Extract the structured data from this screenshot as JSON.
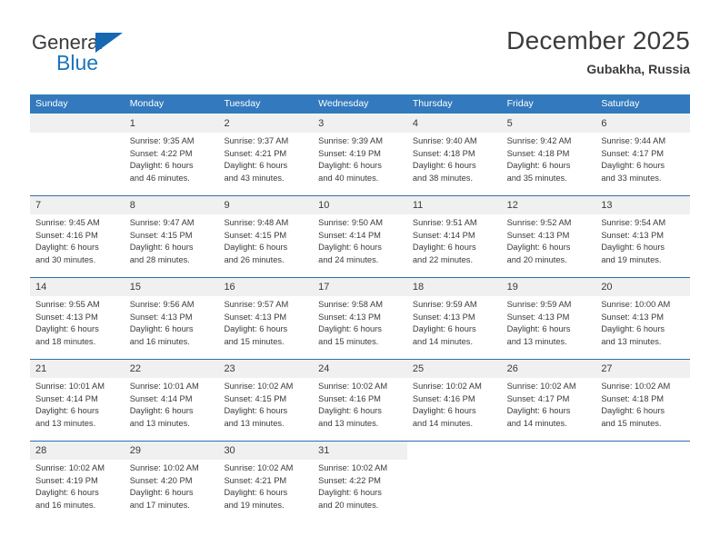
{
  "brand": {
    "name_top": "General",
    "name_bottom": "Blue",
    "triangle_icon": "blue-triangle-logo-mark",
    "colors": {
      "blue": "#1b75bc",
      "dark": "#3a3a3a"
    }
  },
  "header": {
    "title": "December 2025",
    "subtitle": "Gubakha, Russia"
  },
  "calendar": {
    "header_bg": "#3379bd",
    "header_text_color": "#ffffff",
    "daynum_band_bg": "#f0f0f0",
    "week_separator_color": "#2f6fb0",
    "weekdays": [
      "Sunday",
      "Monday",
      "Tuesday",
      "Wednesday",
      "Thursday",
      "Friday",
      "Saturday"
    ],
    "weeks": [
      [
        {
          "day": "",
          "lines": []
        },
        {
          "day": "1",
          "lines": [
            "Sunrise: 9:35 AM",
            "Sunset: 4:22 PM",
            "Daylight: 6 hours",
            "and 46 minutes."
          ]
        },
        {
          "day": "2",
          "lines": [
            "Sunrise: 9:37 AM",
            "Sunset: 4:21 PM",
            "Daylight: 6 hours",
            "and 43 minutes."
          ]
        },
        {
          "day": "3",
          "lines": [
            "Sunrise: 9:39 AM",
            "Sunset: 4:19 PM",
            "Daylight: 6 hours",
            "and 40 minutes."
          ]
        },
        {
          "day": "4",
          "lines": [
            "Sunrise: 9:40 AM",
            "Sunset: 4:18 PM",
            "Daylight: 6 hours",
            "and 38 minutes."
          ]
        },
        {
          "day": "5",
          "lines": [
            "Sunrise: 9:42 AM",
            "Sunset: 4:18 PM",
            "Daylight: 6 hours",
            "and 35 minutes."
          ]
        },
        {
          "day": "6",
          "lines": [
            "Sunrise: 9:44 AM",
            "Sunset: 4:17 PM",
            "Daylight: 6 hours",
            "and 33 minutes."
          ]
        }
      ],
      [
        {
          "day": "7",
          "lines": [
            "Sunrise: 9:45 AM",
            "Sunset: 4:16 PM",
            "Daylight: 6 hours",
            "and 30 minutes."
          ]
        },
        {
          "day": "8",
          "lines": [
            "Sunrise: 9:47 AM",
            "Sunset: 4:15 PM",
            "Daylight: 6 hours",
            "and 28 minutes."
          ]
        },
        {
          "day": "9",
          "lines": [
            "Sunrise: 9:48 AM",
            "Sunset: 4:15 PM",
            "Daylight: 6 hours",
            "and 26 minutes."
          ]
        },
        {
          "day": "10",
          "lines": [
            "Sunrise: 9:50 AM",
            "Sunset: 4:14 PM",
            "Daylight: 6 hours",
            "and 24 minutes."
          ]
        },
        {
          "day": "11",
          "lines": [
            "Sunrise: 9:51 AM",
            "Sunset: 4:14 PM",
            "Daylight: 6 hours",
            "and 22 minutes."
          ]
        },
        {
          "day": "12",
          "lines": [
            "Sunrise: 9:52 AM",
            "Sunset: 4:13 PM",
            "Daylight: 6 hours",
            "and 20 minutes."
          ]
        },
        {
          "day": "13",
          "lines": [
            "Sunrise: 9:54 AM",
            "Sunset: 4:13 PM",
            "Daylight: 6 hours",
            "and 19 minutes."
          ]
        }
      ],
      [
        {
          "day": "14",
          "lines": [
            "Sunrise: 9:55 AM",
            "Sunset: 4:13 PM",
            "Daylight: 6 hours",
            "and 18 minutes."
          ]
        },
        {
          "day": "15",
          "lines": [
            "Sunrise: 9:56 AM",
            "Sunset: 4:13 PM",
            "Daylight: 6 hours",
            "and 16 minutes."
          ]
        },
        {
          "day": "16",
          "lines": [
            "Sunrise: 9:57 AM",
            "Sunset: 4:13 PM",
            "Daylight: 6 hours",
            "and 15 minutes."
          ]
        },
        {
          "day": "17",
          "lines": [
            "Sunrise: 9:58 AM",
            "Sunset: 4:13 PM",
            "Daylight: 6 hours",
            "and 15 minutes."
          ]
        },
        {
          "day": "18",
          "lines": [
            "Sunrise: 9:59 AM",
            "Sunset: 4:13 PM",
            "Daylight: 6 hours",
            "and 14 minutes."
          ]
        },
        {
          "day": "19",
          "lines": [
            "Sunrise: 9:59 AM",
            "Sunset: 4:13 PM",
            "Daylight: 6 hours",
            "and 13 minutes."
          ]
        },
        {
          "day": "20",
          "lines": [
            "Sunrise: 10:00 AM",
            "Sunset: 4:13 PM",
            "Daylight: 6 hours",
            "and 13 minutes."
          ]
        }
      ],
      [
        {
          "day": "21",
          "lines": [
            "Sunrise: 10:01 AM",
            "Sunset: 4:14 PM",
            "Daylight: 6 hours",
            "and 13 minutes."
          ]
        },
        {
          "day": "22",
          "lines": [
            "Sunrise: 10:01 AM",
            "Sunset: 4:14 PM",
            "Daylight: 6 hours",
            "and 13 minutes."
          ]
        },
        {
          "day": "23",
          "lines": [
            "Sunrise: 10:02 AM",
            "Sunset: 4:15 PM",
            "Daylight: 6 hours",
            "and 13 minutes."
          ]
        },
        {
          "day": "24",
          "lines": [
            "Sunrise: 10:02 AM",
            "Sunset: 4:16 PM",
            "Daylight: 6 hours",
            "and 13 minutes."
          ]
        },
        {
          "day": "25",
          "lines": [
            "Sunrise: 10:02 AM",
            "Sunset: 4:16 PM",
            "Daylight: 6 hours",
            "and 14 minutes."
          ]
        },
        {
          "day": "26",
          "lines": [
            "Sunrise: 10:02 AM",
            "Sunset: 4:17 PM",
            "Daylight: 6 hours",
            "and 14 minutes."
          ]
        },
        {
          "day": "27",
          "lines": [
            "Sunrise: 10:02 AM",
            "Sunset: 4:18 PM",
            "Daylight: 6 hours",
            "and 15 minutes."
          ]
        }
      ],
      [
        {
          "day": "28",
          "lines": [
            "Sunrise: 10:02 AM",
            "Sunset: 4:19 PM",
            "Daylight: 6 hours",
            "and 16 minutes."
          ]
        },
        {
          "day": "29",
          "lines": [
            "Sunrise: 10:02 AM",
            "Sunset: 4:20 PM",
            "Daylight: 6 hours",
            "and 17 minutes."
          ]
        },
        {
          "day": "30",
          "lines": [
            "Sunrise: 10:02 AM",
            "Sunset: 4:21 PM",
            "Daylight: 6 hours",
            "and 19 minutes."
          ]
        },
        {
          "day": "31",
          "lines": [
            "Sunrise: 10:02 AM",
            "Sunset: 4:22 PM",
            "Daylight: 6 hours",
            "and 20 minutes."
          ]
        },
        {
          "day": "",
          "lines": [],
          "blank": true
        },
        {
          "day": "",
          "lines": [],
          "blank": true
        },
        {
          "day": "",
          "lines": [],
          "blank": true
        }
      ]
    ]
  }
}
